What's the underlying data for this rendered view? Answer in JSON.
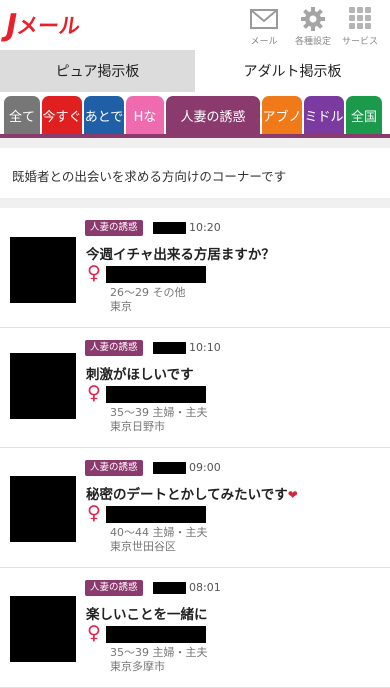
{
  "header": {
    "logo_j": "J",
    "logo_rest": "メール",
    "buttons": [
      {
        "label": "メール",
        "icon": "mail-icon"
      },
      {
        "label": "各種設定",
        "icon": "gear-icon"
      },
      {
        "label": "サービス",
        "icon": "grid-icon"
      }
    ]
  },
  "board_tabs": [
    {
      "label": "ピュア掲示板",
      "active": true
    },
    {
      "label": "アダルト掲示板",
      "active": false
    }
  ],
  "categories": [
    {
      "label": "全て",
      "color": "#777777"
    },
    {
      "label": "今すぐ",
      "color": "#e02020"
    },
    {
      "label": "あとで",
      "color": "#1f5fa6"
    },
    {
      "label": "Hな",
      "color": "#f06ab0"
    },
    {
      "label": "人妻の誘惑",
      "color": "#8b3a6d"
    },
    {
      "label": "アブノ",
      "color": "#f07a1a"
    },
    {
      "label": "ミドル",
      "color": "#7a3aa0"
    },
    {
      "label": "全国",
      "color": "#1a9a4a"
    }
  ],
  "description": "既婚者との出会いを求める方向けのコーナーです",
  "posts": [
    {
      "badge": "人妻の誘惑",
      "time": "10:20",
      "title": "今週イチャ出来る方居ますか？",
      "heart": "",
      "info1": "26〜29 その他",
      "info2": "東京"
    },
    {
      "badge": "人妻の誘惑",
      "time": "10:10",
      "title": "刺激がほしいです",
      "heart": "",
      "info1": "35〜39 主婦・主夫",
      "info2": "東京日野市"
    },
    {
      "badge": "人妻の誘惑",
      "time": "09:00",
      "title": "秘密のデートとかしてみたいです",
      "heart": "❤",
      "info1": "40〜44 主婦・主夫",
      "info2": "東京世田谷区"
    },
    {
      "badge": "人妻の誘惑",
      "time": "08:01",
      "title": "楽しいことを一緒に",
      "heart": "",
      "info1": "35〜39 主婦・主夫",
      "info2": "東京多摩市"
    }
  ],
  "colors": {
    "brand_red": "#e8202a",
    "category_accent": "#8b3a6d",
    "female_symbol": "#e6214a"
  },
  "female_symbol": "♀"
}
